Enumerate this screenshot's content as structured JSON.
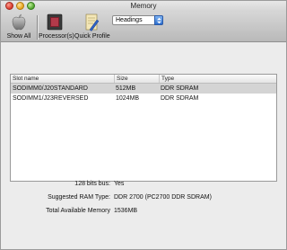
{
  "window": {
    "title": "Memory"
  },
  "toolbar": {
    "show_all_label": "Show All",
    "processors_label": "Processor(s)",
    "quick_profile_label": "Quick Profile",
    "view_select": {
      "selected": "Headings"
    }
  },
  "table": {
    "columns": [
      "Slot name",
      "Size",
      "Type"
    ],
    "rows": [
      {
        "slot": "SODIMM0/J20STANDARD",
        "size": "512MB",
        "type": "DDR SDRAM",
        "selected": true
      },
      {
        "slot": "SODIMM1/J23REVERSED",
        "size": "1024MB",
        "type": "DDR SDRAM",
        "selected": false
      }
    ]
  },
  "details": {
    "bus_label": "128 bits bus:",
    "bus_value": "Yes",
    "ram_type_label": "Suggested RAM Type:",
    "ram_type_value": "DDR 2700 (PC2700 DDR SDRAM)",
    "total_label": "Total Available Memory",
    "total_value": "1536MB"
  },
  "colors": {
    "selection": "#d4d4d4",
    "select_accent": "#2d6fcf"
  }
}
